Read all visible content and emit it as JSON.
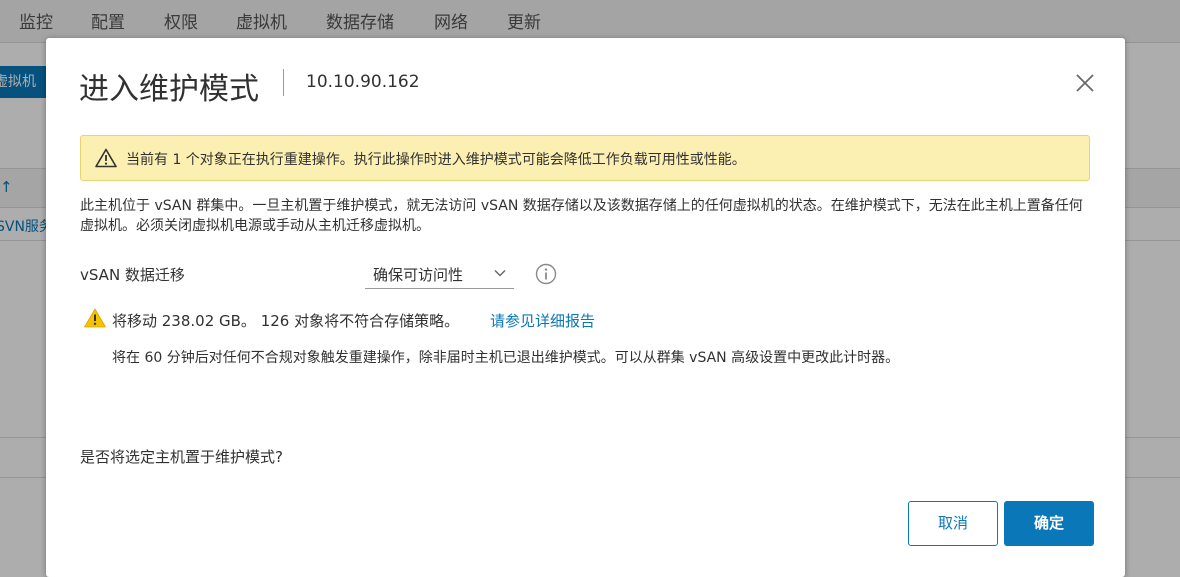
{
  "background": {
    "tabs": [
      {
        "label": "监控"
      },
      {
        "label": "配置"
      },
      {
        "label": "权限"
      },
      {
        "label": "虚拟机"
      },
      {
        "label": "数据存储"
      },
      {
        "label": "网络"
      },
      {
        "label": "更新"
      }
    ],
    "action_button_label": "虚拟机",
    "sort_arrow": "↑",
    "row_text": "SVN服务"
  },
  "modal": {
    "title": "进入维护模式",
    "host": "10.10.90.162",
    "close_icon": "close-icon",
    "warning_banner": "当前有 1 个对象正在执行重建操作。执行此操作时进入维护模式可能会降低工作负载可用性或性能。",
    "description": "此主机位于 vSAN 群集中。一旦主机置于维护模式，就无法访问 vSAN 数据存储以及该数据存储上的任何虚拟机的状态。在维护模式下，无法在此主机上置备任何虚拟机。必须关闭虚拟机电源或手动从主机迁移虚拟机。",
    "migration_label": "vSAN 数据迁移",
    "migration_value": "确保可访问性",
    "move_text": "将移动 238.02 GB。 126 对象将不符合存储策略。",
    "report_link": "请参见详细报告",
    "timer_text": "将在 60 分钟后对任何不合规对象触发重建操作，除非届时主机已退出维护模式。可以从群集 vSAN 高级设置中更改此计时器。",
    "question": "是否将选定主机置于维护模式?",
    "cancel_label": "取消",
    "ok_label": "确定"
  },
  "colors": {
    "accent": "#0a78b8",
    "warning_bg": "#fcefb2",
    "warning_icon": "#f5c300"
  }
}
